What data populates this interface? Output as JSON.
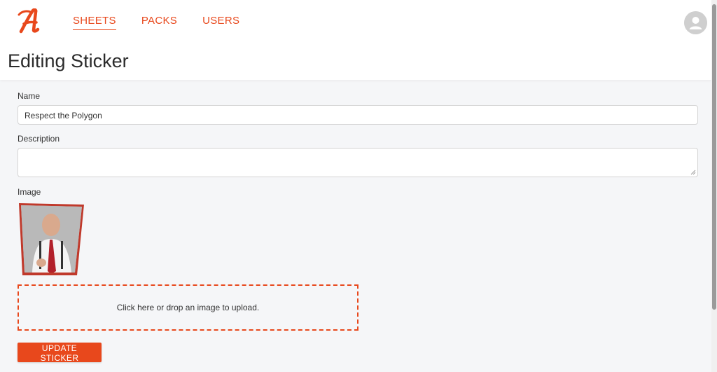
{
  "header": {
    "logo_letter": "A",
    "nav": [
      {
        "label": "SHEETS",
        "active": true
      },
      {
        "label": "PACKS",
        "active": false
      },
      {
        "label": "USERS",
        "active": false
      }
    ],
    "avatar_icon": "user-avatar-icon"
  },
  "page": {
    "title": "Editing Sticker"
  },
  "form": {
    "name_label": "Name",
    "name_value": "Respect the Polygon",
    "description_label": "Description",
    "description_value": "",
    "image_label": "Image",
    "dropzone_text": "Click here or drop an image to upload.",
    "submit_label": "UPDATE STICKER"
  },
  "colors": {
    "accent": "#e8481c",
    "background": "#f5f6f8",
    "sticker_border": "#c0392b"
  }
}
